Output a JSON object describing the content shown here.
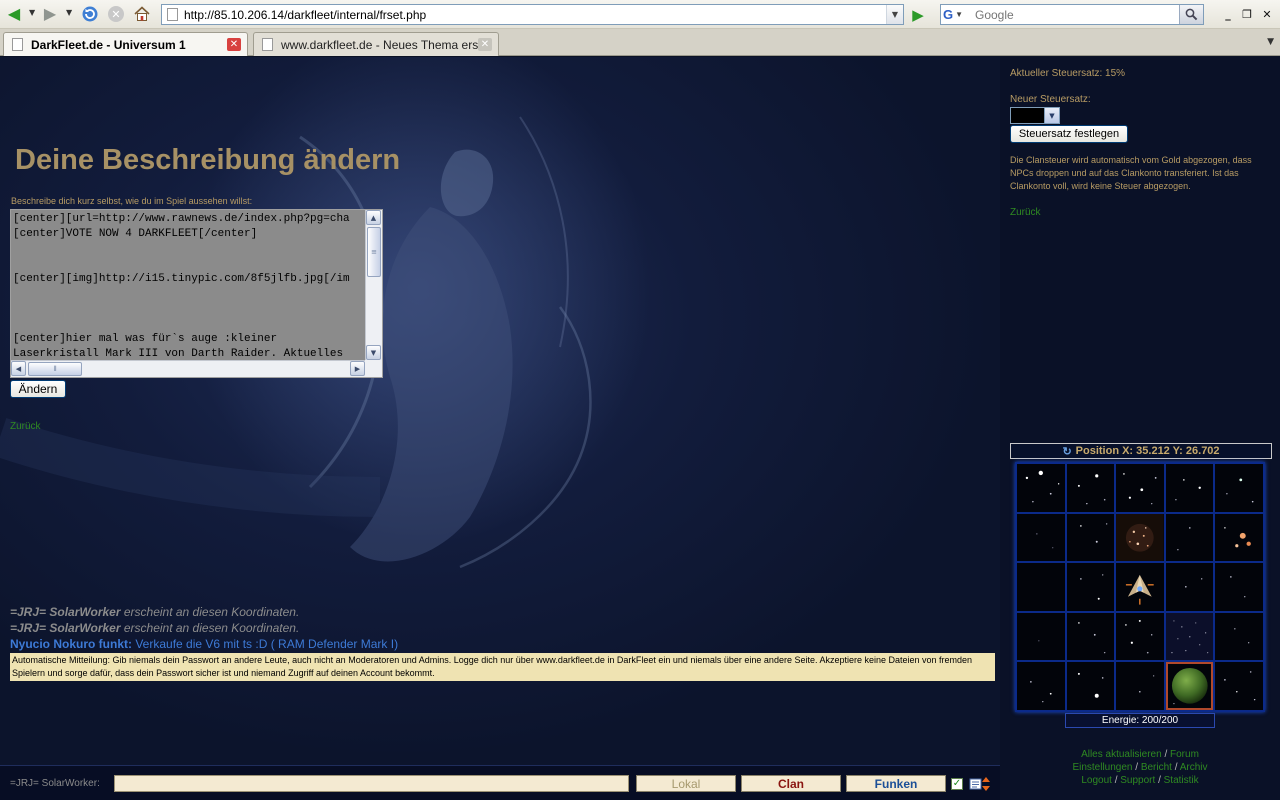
{
  "browser": {
    "url": "http://85.10.206.14/darkfleet/internal/frset.php",
    "search_placeholder": "Google",
    "tabs": [
      {
        "label": "DarkFleet.de - Universum 1",
        "active": true
      },
      {
        "label": "www.darkfleet.de - Neues Thema erst...",
        "active": false
      }
    ]
  },
  "main": {
    "title": "Deine Beschreibung ändern",
    "description_label": "Beschreibe dich kurz selbst, wie du im Spiel aussehen willst:",
    "description_text": "[center][url=http://www.rawnews.de/index.php?pg=cha\n[center]VOTE NOW 4 DARKFLEET[/center]\n\n\n[center][img]http://i15.tinypic.com/8f5jlfb.jpg[/im\n\n\n\n[center]hier mal was für`s auge :kleiner\nLaserkristall Mark III von Darth Raider. Aktuelles",
    "submit_label": "Ändern",
    "back_label": "Zurück"
  },
  "chat": {
    "log": [
      {
        "user": "=JRJ= SolarWorker",
        "text": " erscheint an diesen Koordinaten.",
        "style": "system"
      },
      {
        "user": "=JRJ= SolarWorker",
        "text": " erscheint an diesen Koordinaten.",
        "style": "system"
      },
      {
        "user": "Nyucio Nokuro funkt:",
        "text": " Verkaufe die V6 mit ts :D ( RAM Defender Mark I)",
        "style": "radio"
      }
    ],
    "auto_message": "Automatische Mitteilung: Gib niemals dein Passwort an andere Leute, auch nicht an Moderatoren und Admins. Logge dich nur über www.darkfleet.de in DarkFleet ein und niemals über eine andere Seite. Akzeptiere keine Dateien von fremden Spielern und sorge dafür, dass dein Passwort sicher ist und niemand Zugriff auf deinen Account bekommt.",
    "current_user": "=JRJ= SolarWorker:",
    "input_value": "",
    "channels": {
      "local": "Lokal",
      "clan": "Clan",
      "radio": "Funken"
    }
  },
  "side": {
    "tax_current": "Aktueller Steuersatz: 15%",
    "tax_new_label": "Neuer Steuersatz:",
    "tax_submit": "Steuersatz festlegen",
    "tax_info": "Die Clansteuer wird automatisch vom Gold abgezogen, dass NPCs droppen und auf das Clankonto transferiert. Ist das Clankonto voll, wird keine Steuer abgezogen.",
    "back_label": "Zurück",
    "position": "Position X: 35.212 Y: 26.702",
    "energy": "Energie: 200/200",
    "links": {
      "refresh_all": "Alles aktualisieren",
      "forum": "Forum",
      "settings": "Einstellungen",
      "report": "Bericht",
      "archive": "Archiv",
      "logout": "Logout",
      "support": "Support",
      "statistics": "Statistik"
    }
  },
  "colors": {
    "gold": "#b89c64",
    "link_green": "#2f8a22",
    "radio_blue": "#3d7ad6",
    "grid_blue": "#0b2a8a",
    "active_sector": "#b0492c"
  }
}
